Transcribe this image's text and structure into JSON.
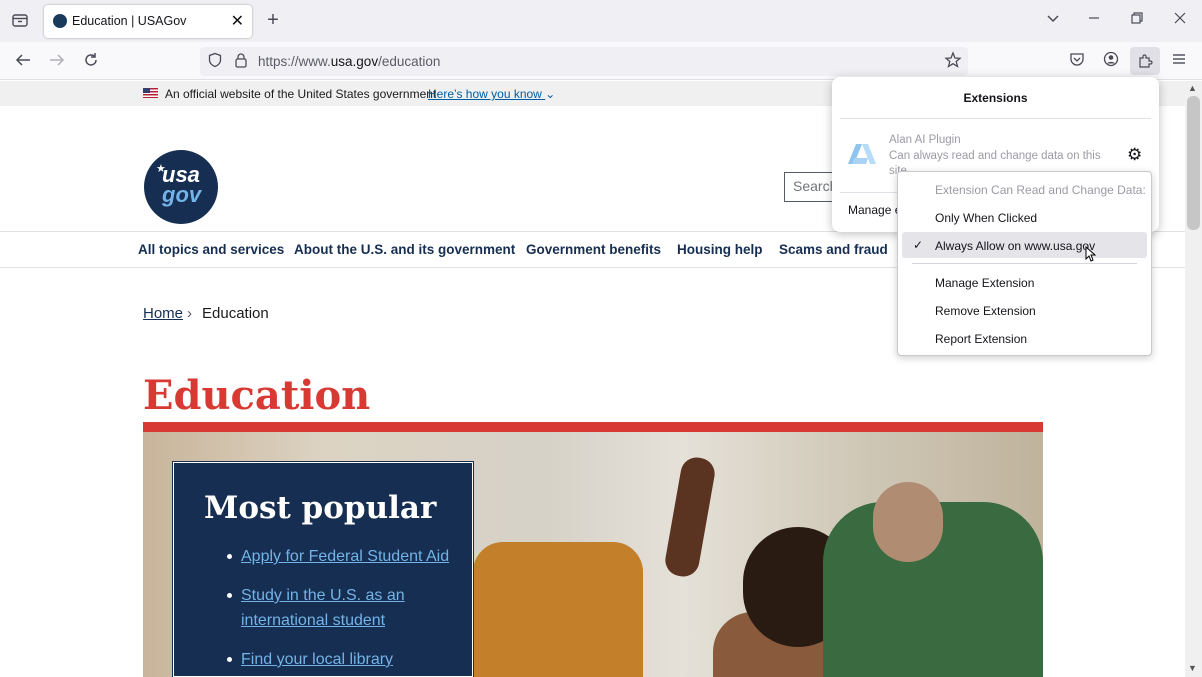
{
  "browser": {
    "tab_title": "Education | USAGov",
    "tab_close": "✕",
    "new_tab": "+",
    "url_prefix": "https://www.",
    "url_domain": "usa.gov",
    "url_path": "/education"
  },
  "gov_banner": {
    "text": "An official website of the United States government",
    "link": "Here’s how you know"
  },
  "site": {
    "logo_top": "usa",
    "logo_bottom": "gov",
    "search_placeholder": "Search",
    "nav": [
      "All topics and services",
      "About the U.S. and its government",
      "Government benefits",
      "Housing help",
      "Scams and fraud"
    ]
  },
  "breadcrumb": {
    "home": "Home",
    "separator": "›",
    "current": "Education"
  },
  "page_title": "Education",
  "most_popular": {
    "title": "Most popular",
    "links": [
      "Apply for Federal Student Aid",
      "Study in the U.S. as an",
      "international student",
      "Find your local library"
    ]
  },
  "extensions_panel": {
    "title": "Extensions",
    "extension_name": "Alan AI Plugin",
    "extension_desc": "Can always read and change data on this site",
    "manage": "Manage e"
  },
  "context_menu": {
    "header": "Extension Can Read and Change Data:",
    "items": [
      "Only When Clicked",
      "Always Allow on www.usa.gov",
      "Manage Extension",
      "Remove Extension",
      "Report Extension"
    ],
    "checkmark": "✓"
  },
  "colors": {
    "brand_navy": "#162e51",
    "accent_red": "#d83933",
    "link_blue": "#005ea2"
  }
}
